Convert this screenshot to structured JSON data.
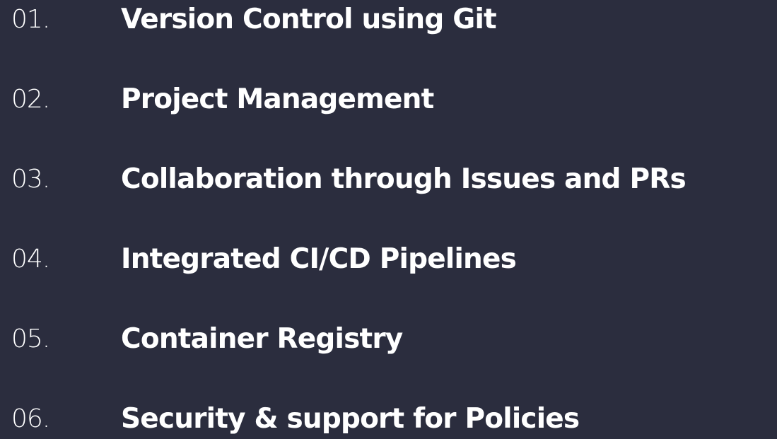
{
  "colors": {
    "background": "#2b2d3e",
    "text": "#ffffff"
  },
  "items": [
    {
      "number": "01.",
      "title": "Version Control using Git"
    },
    {
      "number": "02.",
      "title": "Project Management"
    },
    {
      "number": "03.",
      "title": "Collaboration through Issues and PRs"
    },
    {
      "number": "04.",
      "title": "Integrated CI/CD Pipelines"
    },
    {
      "number": "05.",
      "title": "Container Registry"
    },
    {
      "number": "06.",
      "title": "Security & support for Policies"
    }
  ]
}
